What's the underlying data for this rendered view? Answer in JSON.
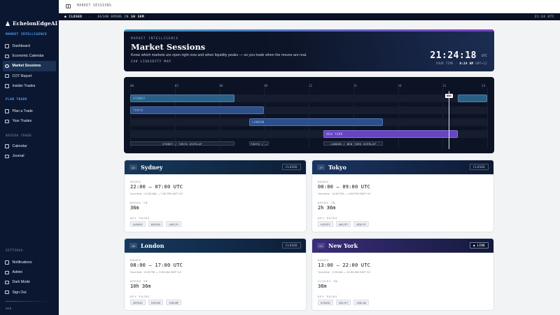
{
  "sidebar": {
    "brand": "EchelonEdgeAI",
    "sections": [
      {
        "title": "MARKET INTELLIGENCE",
        "color": "#4aa3ff",
        "items": [
          {
            "label": "Dashboard",
            "icon": "grid-icon"
          },
          {
            "label": "Economic Calendar",
            "icon": "calendar-icon"
          },
          {
            "label": "Market Sessions",
            "icon": "globe-icon",
            "active": true
          },
          {
            "label": "COT Report",
            "icon": "document-icon"
          },
          {
            "label": "Insider Trades",
            "icon": "briefcase-icon"
          }
        ]
      },
      {
        "title": "PLAN TRADE",
        "color": "#4aa3ff",
        "items": [
          {
            "label": "Plan a Trade",
            "icon": "plus-icon"
          },
          {
            "label": "Your Trades",
            "icon": "list-icon"
          }
        ]
      },
      {
        "title": "REVIEW TRADE",
        "color": "#5c6b84",
        "items": [
          {
            "label": "Calendar",
            "icon": "calendar-icon"
          },
          {
            "label": "Journal",
            "icon": "book-icon"
          }
        ]
      },
      {
        "title": "SETTINGS",
        "color": "#5c6b84",
        "items": [
          {
            "label": "Notifications",
            "icon": "bell-icon"
          },
          {
            "label": "Admin",
            "icon": "shield-icon"
          },
          {
            "label": "Dark Mode",
            "icon": "moon-icon"
          },
          {
            "label": "Sign Out",
            "icon": "logout-icon"
          }
        ]
      }
    ],
    "version": "v2.0"
  },
  "topbar": {
    "breadcrumb": "MARKET SESSIONS"
  },
  "ticker": {
    "status": "CLOSED",
    "message_prefix": "ASIAN OPENS IN",
    "message_time": "1H 36M",
    "time": "21:24 UTC"
  },
  "hero": {
    "eyebrow": "MARKET INTELLIGENCE",
    "title": "Market Sessions",
    "subtitle": "Know which markets are open right now and when liquidity peaks — so you trade when the moves are real.",
    "map_label": "24H LIQUIDITY MAP",
    "clock": "21:24:18",
    "clock_unit": "UTC",
    "your_time_label": "YOUR TIME ·",
    "your_time": "9:24 AM",
    "timezone": "GMT+12"
  },
  "map": {
    "ticks": [
      "00",
      "03",
      "06",
      "09",
      "12",
      "15",
      "18",
      "21",
      "24"
    ],
    "now_hour": 21.4,
    "now_label": "NOW",
    "sessions": [
      {
        "name": "SYDNEY",
        "start": 22,
        "end": 7,
        "color": "#2a5f86",
        "text": "#8fd0f0"
      },
      {
        "name": "TOKYO",
        "start": 0,
        "end": 9,
        "color": "#2d4f8a",
        "text": "#9fb8ea"
      },
      {
        "name": "LONDON",
        "start": 8,
        "end": 17,
        "color": "#2b4f8c",
        "text": "#a8c3f2"
      },
      {
        "name": "NEW YORK",
        "start": 13,
        "end": 22,
        "color": "#6545c4",
        "text": "#d6ccff"
      }
    ],
    "overlaps": [
      {
        "label": "SYDNEY / TOKYO OVERLAP",
        "start": 0,
        "end": 7
      },
      {
        "label": "TOKYO / …",
        "start": 8,
        "end": 9.3
      },
      {
        "label": "LONDON / NEW YORK OVERLAP",
        "start": 13,
        "end": 17
      }
    ]
  },
  "cards": [
    {
      "code": "AU",
      "name": "Sydney",
      "status": "CLOSED",
      "hours_label": "HOURS",
      "hours": "22:00 — 07:00 UTC",
      "your_time": "Your time · 10:00 AM — 7:00 PM GMT+12",
      "countdown_label": "OPENS IN",
      "countdown": "36m",
      "pairs_label": "KEY PAIRS",
      "pairs": [
        "AUDUSD",
        "NZDUSD",
        "AUDJPY"
      ],
      "gradient": [
        "#16385a",
        "#0d1e36"
      ]
    },
    {
      "code": "JP",
      "name": "Tokyo",
      "status": "CLOSED",
      "hours_label": "HOURS",
      "hours": "00:00 — 09:00 UTC",
      "your_time": "Your time · 12:00 PM — 9:00 PM GMT+12",
      "countdown_label": "OPENS IN",
      "countdown": "2h 36m",
      "pairs_label": "KEY PAIRS",
      "pairs": [
        "USDJPY",
        "AUDJPY",
        "NZDJPY"
      ],
      "gradient": [
        "#1b3563",
        "#0e1a33"
      ]
    },
    {
      "code": "GB",
      "name": "London",
      "status": "CLOSED",
      "hours_label": "HOURS",
      "hours": "08:00 — 17:00 UTC",
      "your_time": "Your time · 8:00 PM — 5:00 AM GMT+12",
      "countdown_label": "OPENS IN",
      "countdown": "10h 36m",
      "pairs_label": "KEY PAIRS",
      "pairs": [
        "GBPUSD",
        "EURUSD",
        "EURGBP"
      ],
      "gradient": [
        "#163a5e",
        "#0d1e38"
      ]
    },
    {
      "code": "US",
      "name": "New York",
      "status": "● LIVE",
      "live": true,
      "hours_label": "HOURS",
      "hours": "13:00 — 22:00 UTC",
      "your_time": "Your time · 1:00 AM — 10:00 AM GMT+12",
      "countdown_label": "CLOSES IN",
      "countdown": "36m",
      "pairs_label": "KEY PAIRS",
      "pairs": [
        "EURUSD",
        "USDJPY",
        "USDCAD"
      ],
      "gradient": [
        "#3a2d7a",
        "#141a3a"
      ]
    }
  ]
}
